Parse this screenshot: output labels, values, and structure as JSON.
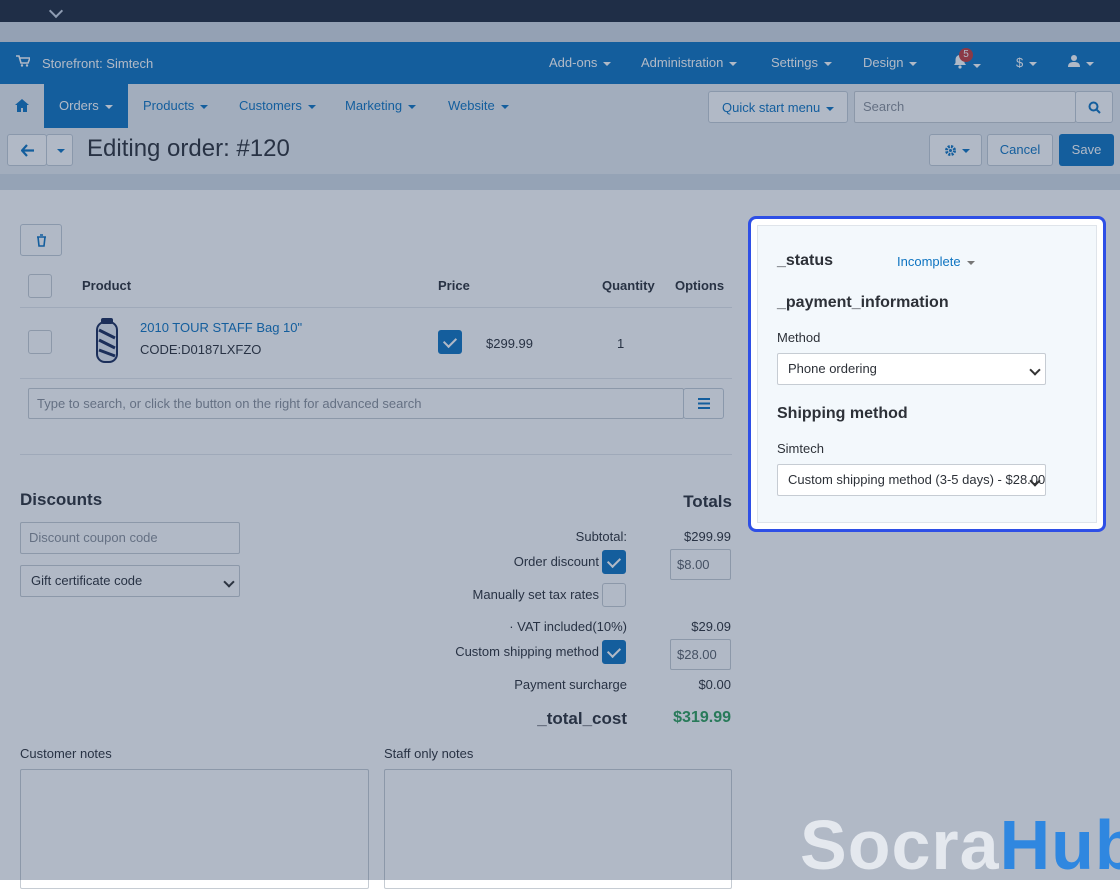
{
  "topbar": {
    "chevron_icon": "chevron-down-icon"
  },
  "header": {
    "storefront_label": "Storefront: Simtech",
    "menu": [
      "Add-ons",
      "Administration",
      "Settings",
      "Design"
    ],
    "notifications_count": "5",
    "currency": "$"
  },
  "nav": {
    "items": [
      "Orders",
      "Products",
      "Customers",
      "Marketing",
      "Website"
    ],
    "quick_start": "Quick start menu",
    "search_placeholder": "Search"
  },
  "toolbar": {
    "title": "Editing order: #120",
    "cancel": "Cancel",
    "save": "Save"
  },
  "products_table": {
    "headers": {
      "product": "Product",
      "price": "Price",
      "quantity": "Quantity",
      "options": "Options"
    },
    "rows": [
      {
        "name": "2010 TOUR STAFF Bag 10\"",
        "code": "CODE:D0187LXFZO",
        "price": "$299.99",
        "quantity": "1"
      }
    ],
    "search_placeholder": "Type to search, or click the button on the right for advanced search"
  },
  "discounts": {
    "title": "Discounts",
    "coupon_placeholder": "Discount coupon code",
    "gift_certificate": "Gift certificate code"
  },
  "totals": {
    "title": "Totals",
    "subtotal_label": "Subtotal:",
    "subtotal_value": "$299.99",
    "order_discount_label": "Order discount",
    "order_discount_value": "$8.00",
    "manual_tax_label": "Manually set tax rates",
    "vat_label": "· VAT included(10%)",
    "vat_value": "$29.09",
    "custom_shipping_label": "Custom shipping method",
    "custom_shipping_value": "$28.00",
    "payment_surcharge_label": "Payment surcharge",
    "payment_surcharge_value": "$0.00",
    "total_label": "_total_cost",
    "total_value": "$319.99"
  },
  "notes": {
    "customer_label": "Customer notes",
    "staff_label": "Staff only notes"
  },
  "side_panel": {
    "status_label": "_status",
    "status_value": "Incomplete",
    "payment_title": "_payment_information",
    "method_label": "Method",
    "method_value": "Phone ordering",
    "shipping_title": "Shipping method",
    "carrier_label": "Simtech",
    "shipping_value": "Custom shipping method (3-5 days) - $28.00"
  },
  "watermark": {
    "part1": "Socra",
    "part2": "Hub"
  },
  "colors": {
    "brand": "#0e74c1",
    "highlight": "#2e4fe6",
    "total": "#2e9f5a"
  }
}
